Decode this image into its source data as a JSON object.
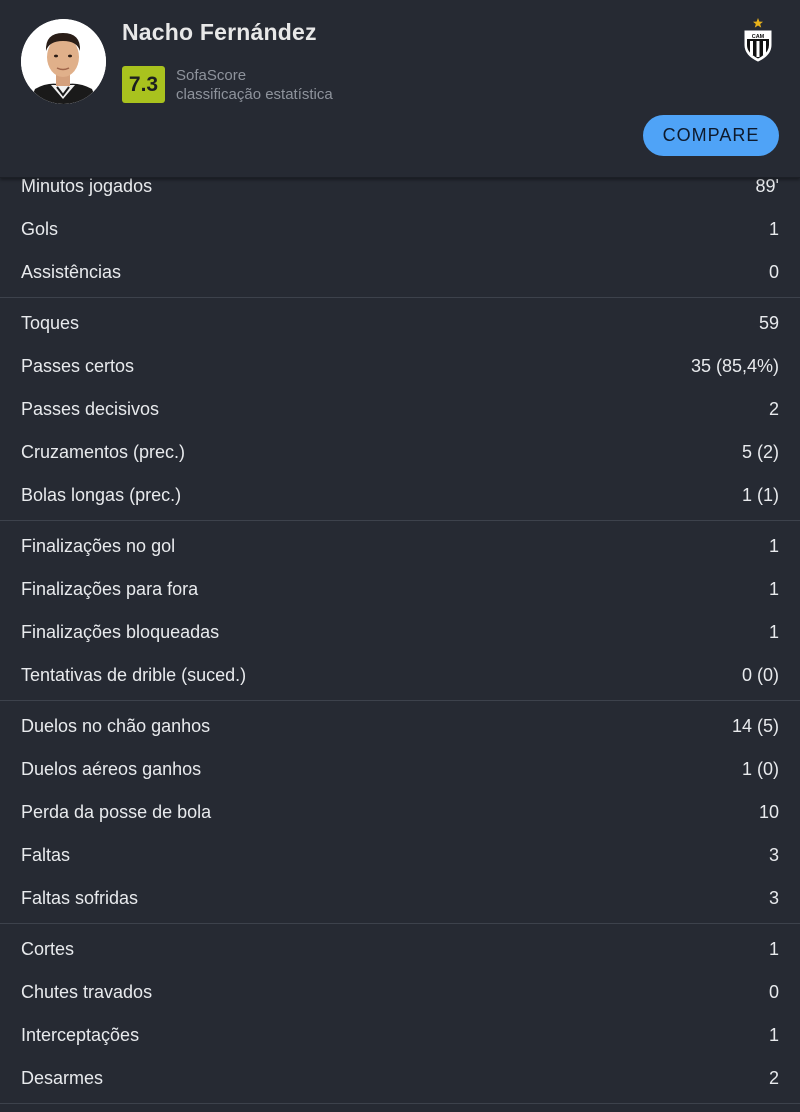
{
  "player": {
    "name": "Nacho Fernández",
    "rating": "7.3",
    "rating_source_line1": "SofaScore",
    "rating_source_line2": "classificação estatística"
  },
  "actions": {
    "compare_label": "COMPARE"
  },
  "icons": {
    "avatar": "player-photo",
    "club": "atletico-mineiro-crest"
  },
  "colors": {
    "background": "#262a33",
    "rating_badge": "#a9c21e",
    "compare_button": "#4fa3f7",
    "divider": "#3d424c"
  },
  "stat_groups": [
    [
      {
        "label": "Minutos jogados",
        "value": "89'"
      },
      {
        "label": "Gols",
        "value": "1"
      },
      {
        "label": "Assistências",
        "value": "0"
      }
    ],
    [
      {
        "label": "Toques",
        "value": "59"
      },
      {
        "label": "Passes certos",
        "value": "35 (85,4%)"
      },
      {
        "label": "Passes decisivos",
        "value": "2"
      },
      {
        "label": "Cruzamentos (prec.)",
        "value": "5 (2)"
      },
      {
        "label": "Bolas longas (prec.)",
        "value": "1 (1)"
      }
    ],
    [
      {
        "label": "Finalizações no gol",
        "value": "1"
      },
      {
        "label": "Finalizações para fora",
        "value": "1"
      },
      {
        "label": "Finalizações bloqueadas",
        "value": "1"
      },
      {
        "label": "Tentativas de drible (suced.)",
        "value": "0 (0)"
      }
    ],
    [
      {
        "label": "Duelos no chão ganhos",
        "value": "14 (5)"
      },
      {
        "label": "Duelos aéreos ganhos",
        "value": "1 (0)"
      },
      {
        "label": "Perda da posse de bola",
        "value": "10"
      },
      {
        "label": "Faltas",
        "value": "3"
      },
      {
        "label": "Faltas sofridas",
        "value": "3"
      }
    ],
    [
      {
        "label": "Cortes",
        "value": "1"
      },
      {
        "label": "Chutes travados",
        "value": "0"
      },
      {
        "label": "Interceptações",
        "value": "1"
      },
      {
        "label": "Desarmes",
        "value": "2"
      }
    ]
  ]
}
